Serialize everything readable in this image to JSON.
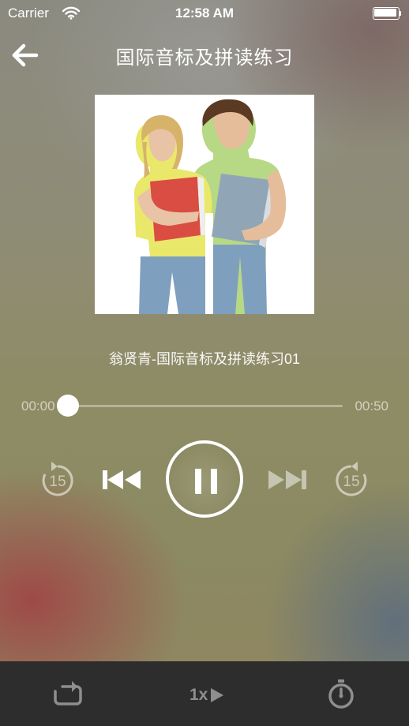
{
  "status_bar": {
    "carrier": "Carrier",
    "time": "12:58 AM",
    "icons": [
      "wifi-icon",
      "battery-icon"
    ]
  },
  "header": {
    "title": "国际音标及拼读练习",
    "back_icon": "arrow-left-icon"
  },
  "cover": {
    "description_icon": "album-cover-image"
  },
  "track": {
    "title": "翁贤青-国际音标及拼读练习01"
  },
  "progress": {
    "current": "00:00",
    "total": "00:50",
    "fraction": 0.0
  },
  "controls": {
    "rewind_label": "15",
    "forward_label": "15",
    "icons": [
      "rewind-15-icon",
      "previous-track-icon",
      "pause-icon",
      "next-track-icon",
      "forward-15-icon"
    ],
    "state": "playing"
  },
  "bottom_bar": {
    "speed_label": "1x",
    "icons": [
      "repeat-icon",
      "play-speed-icon",
      "timer-icon"
    ]
  },
  "colors": {
    "bottom_bar_bg": "#2d2d2d",
    "bottom_icon": "#8e8e8e",
    "accent": "#ffffff"
  }
}
